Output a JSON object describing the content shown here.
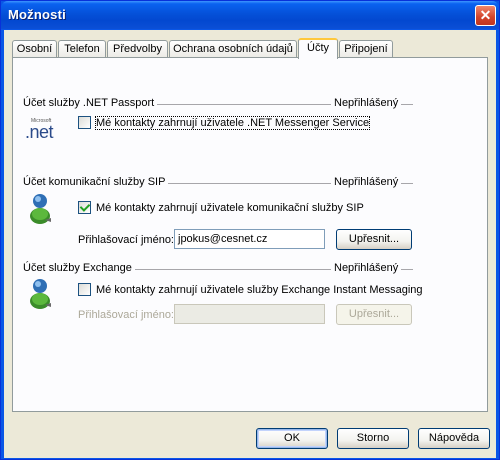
{
  "window": {
    "title": "Možnosti",
    "close_glyph": "✕"
  },
  "tabs": [
    {
      "label": "Osobní"
    },
    {
      "label": "Telefon"
    },
    {
      "label": "Předvolby"
    },
    {
      "label": "Ochrana osobních údajů"
    },
    {
      "label": "Účty",
      "active": true
    },
    {
      "label": "Připojení"
    }
  ],
  "passport": {
    "title": "Účet služby .NET Passport",
    "status": "Nepřihlášený",
    "checkbox_label": "Mé kontakty zahrnují uživatele .NET Messenger Service",
    "checked": false,
    "icon": "net-passport-logo",
    "logo_text": "Microsoft",
    "logo_main": ".net"
  },
  "sip": {
    "title": "Účet komunikační služby SIP",
    "status": "Nepřihlášený",
    "checkbox_label": "Mé  kontakty zahrnují uživatele komunikační služby SIP",
    "checked": true,
    "signin_label": "Přihlašovací jméno:",
    "signin_value": "jpokus@cesnet.cz",
    "refine_button": "Upřesnit...",
    "icon": "messenger-user-icon"
  },
  "exchange": {
    "title": "Účet služby Exchange",
    "status": "Nepřihlášený",
    "checkbox_label": "Mé kontakty zahrnují uživatele služby Exchange Instant Messaging",
    "checked": false,
    "signin_label": "Přihlašovací jméno:",
    "signin_value": "",
    "refine_button": "Upřesnit...",
    "icon": "messenger-user-icon"
  },
  "footer": {
    "ok": "OK",
    "cancel": "Storno",
    "help": "Nápověda"
  },
  "colors": {
    "accent": "#0a56e6",
    "tab_highlight": "#ffc83c",
    "panel_bg": "#fcfcfe",
    "dialog_bg": "#ece9d8"
  }
}
